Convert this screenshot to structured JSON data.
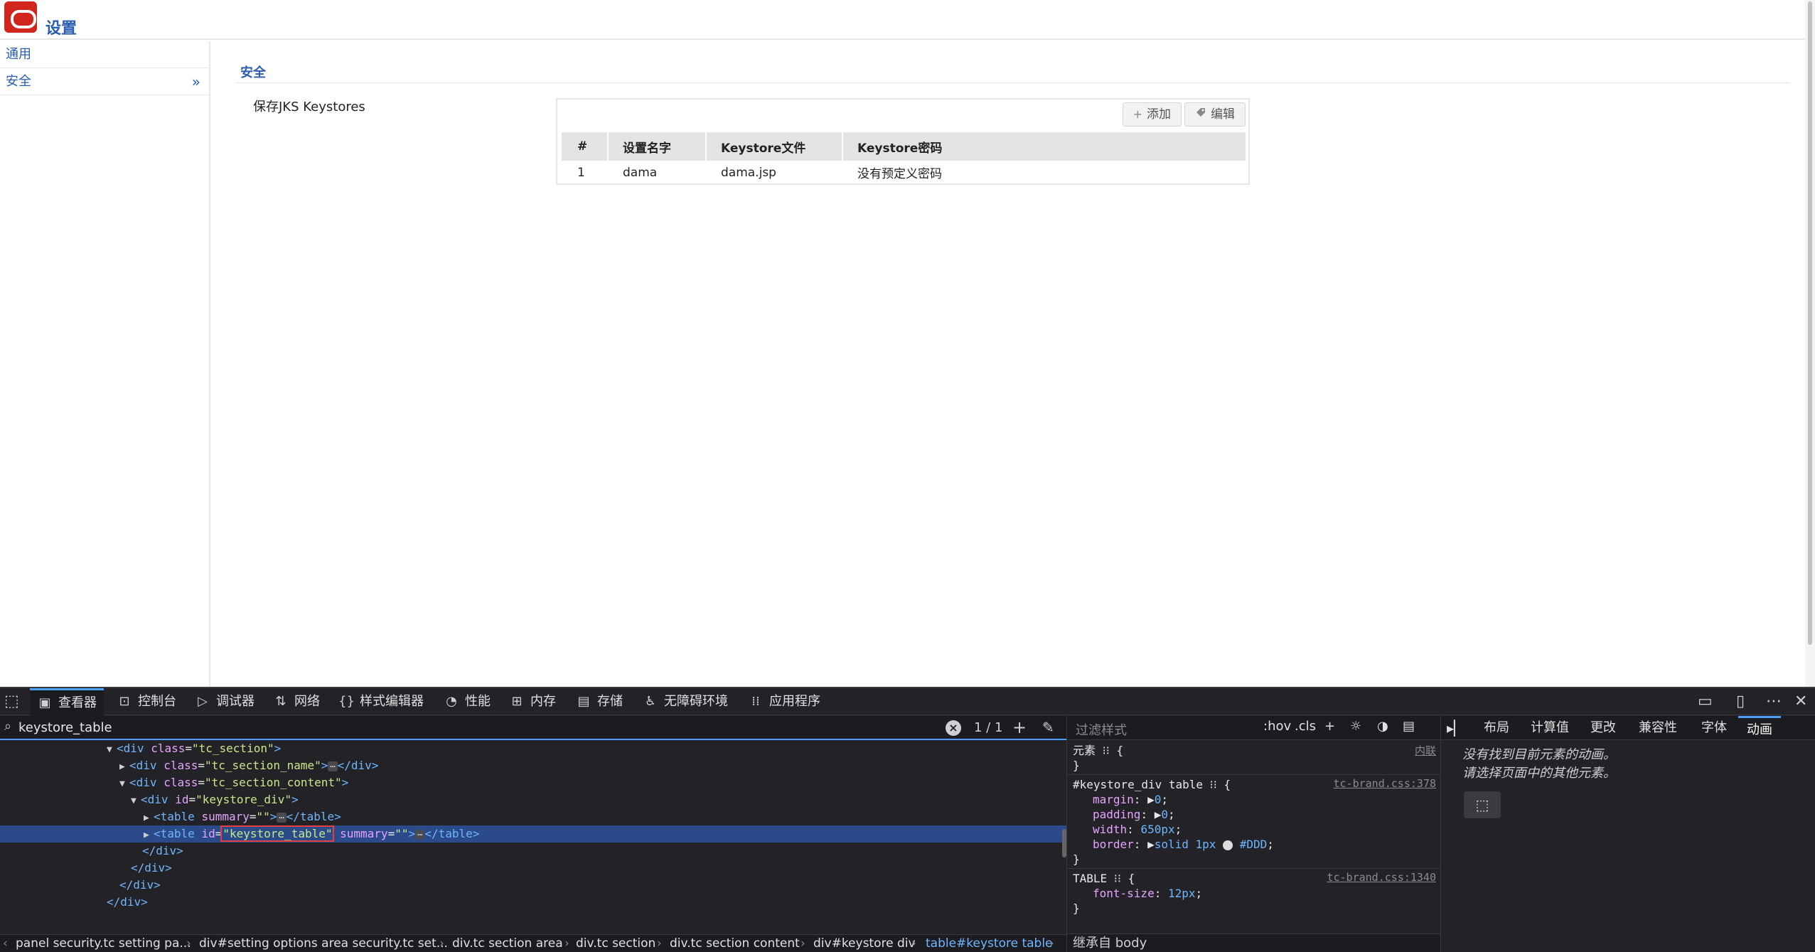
{
  "page": {
    "title": "设置",
    "nav": [
      {
        "label": "通用"
      },
      {
        "label": "安全",
        "chevron": "»"
      }
    ],
    "section_title": "安全",
    "section_name": "保存JKS Keystores",
    "toolbar": {
      "add_label": "添加",
      "add_icon": "+",
      "edit_label": "编辑",
      "edit_icon": "tag-icon"
    },
    "table": {
      "headers": [
        "#",
        "设置名字",
        "Keystore文件",
        "Keystore密码"
      ],
      "rows": [
        [
          "1",
          "dama",
          "dama.jsp",
          "没有预定义密码"
        ]
      ]
    }
  },
  "devtools": {
    "tabs": [
      {
        "label": "查看器",
        "icon": "inspector-icon",
        "active": true
      },
      {
        "label": "控制台",
        "icon": "console-icon"
      },
      {
        "label": "调试器",
        "icon": "debugger-icon"
      },
      {
        "label": "网络",
        "icon": "network-icon"
      },
      {
        "label": "样式编辑器",
        "icon": "style-editor-icon"
      },
      {
        "label": "性能",
        "icon": "performance-icon"
      },
      {
        "label": "内存",
        "icon": "memory-icon"
      },
      {
        "label": "存储",
        "icon": "storage-icon"
      },
      {
        "label": "无障碍环境",
        "icon": "accessibility-icon"
      },
      {
        "label": "应用程序",
        "icon": "application-icon"
      }
    ],
    "search": {
      "value": "keystore_table",
      "count": "1 / 1"
    },
    "markup": {
      "l1": {
        "open": "<",
        "tag": "div",
        "attr": "class",
        "val": "\"tc_section\"",
        "close": ">"
      },
      "l2": {
        "tag": "div",
        "attr": "class",
        "val": "\"tc_section_name\"",
        "end": "</div>"
      },
      "l3": {
        "tag": "div",
        "attr": "class",
        "val": "\"tc_section_content\""
      },
      "l4": {
        "tag": "div",
        "attr": "id",
        "val": "\"keystore_div\""
      },
      "l5": {
        "tag": "table",
        "attr": "summary",
        "val": "\"\"",
        "end": "</table>"
      },
      "l6": {
        "tag": "table",
        "attr": "id",
        "val": "\"keystore_table\"",
        "attr2": "summary",
        "val2": "\"\"",
        "end": "</table>"
      },
      "l7": "</div>",
      "l8": "</div>",
      "l9": "</div>",
      "l10": "</div>"
    },
    "breadcrumb": [
      "panel security.tc setting pa...",
      "div#setting options area security.tc set...",
      "div.tc section area",
      "div.tc section",
      "div.tc section content",
      "div#keystore div",
      "table#keystore table"
    ],
    "rules": {
      "filter_placeholder": "过滤样式",
      "hov": ":hov",
      "cls": ".cls",
      "element_label": "元素",
      "element_source": "内联",
      "rule1_selector": "#keystore_div table",
      "rule1_source": "tc-brand.css:378",
      "rule1_props": [
        {
          "name": "margin",
          "value": "0"
        },
        {
          "name": "padding",
          "value": "0"
        },
        {
          "name": "width",
          "value": "650px"
        },
        {
          "name": "border",
          "value": "solid 1px",
          "color": "#DDD"
        }
      ],
      "rule2_selector": "TABLE",
      "rule2_source": "tc-brand.css:1340",
      "rule2_props": [
        {
          "name": "font-size",
          "value": "12px"
        }
      ],
      "inherited": "继承自 body"
    },
    "side": {
      "tabs": [
        "布局",
        "计算值",
        "更改",
        "兼容性",
        "字体",
        "动画"
      ],
      "active_tab": "动画",
      "message_line1": "没有找到目前元素的动画。",
      "message_line2": "请选择页面中的其他元素。"
    }
  },
  "colors": {
    "brand_red": "#d0261d",
    "link_blue": "#2a5db0",
    "devtools_bg": "#232327",
    "selected_row": "#2a4a8a",
    "accent_blue": "#4d9fff"
  }
}
